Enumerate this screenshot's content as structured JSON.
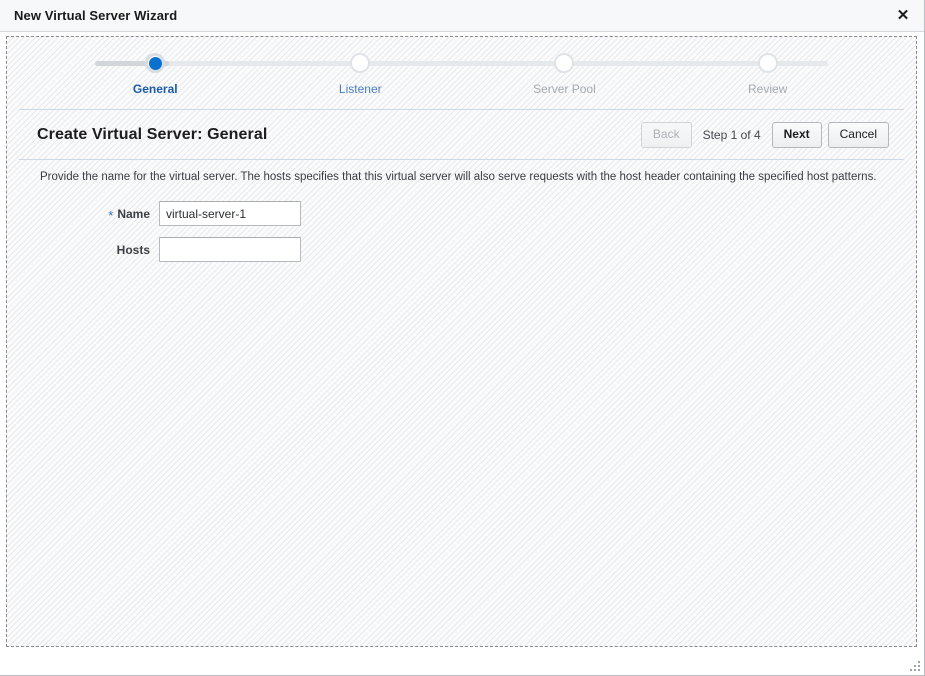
{
  "window": {
    "title": "New Virtual Server Wizard",
    "close_icon": "close-icon",
    "close_glyph": "✕"
  },
  "stepper": {
    "steps": [
      {
        "label": "General",
        "state": "active"
      },
      {
        "label": "Listener",
        "state": "link"
      },
      {
        "label": "Server Pool",
        "state": "disabled"
      },
      {
        "label": "Review",
        "state": "disabled"
      }
    ],
    "active_color": "#1b5aa8",
    "link_color": "#4a7ebb",
    "disabled_color": "#a4aab0",
    "dot_color": "#0a72ce"
  },
  "page": {
    "title": "Create Virtual Server: General",
    "instruction": "Provide the name for the virtual server. The hosts specifies that this virtual server will also serve requests with the host header containing the specified host patterns."
  },
  "actions": {
    "back_label": "Back",
    "step_counter": "Step 1 of 4",
    "next_label": "Next",
    "cancel_label": "Cancel"
  },
  "form": {
    "fields": [
      {
        "label": "Name",
        "required": true,
        "required_marker": "*",
        "value": "virtual-server-1",
        "placeholder": ""
      },
      {
        "label": "Hosts",
        "required": false,
        "required_marker": "",
        "value": "",
        "placeholder": ""
      }
    ]
  }
}
